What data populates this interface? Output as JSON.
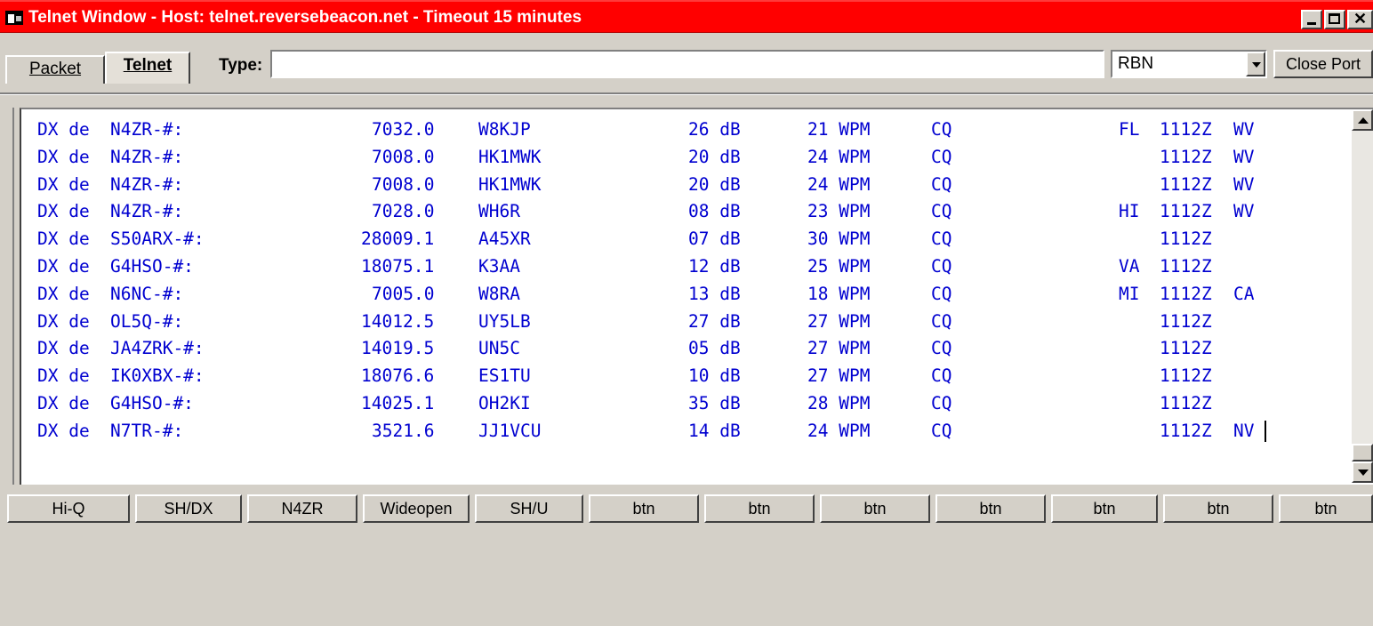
{
  "window": {
    "title": "Telnet Window - Host: telnet.reversebeacon.net - Timeout 15 minutes"
  },
  "tabs": [
    {
      "label": "Packet",
      "active": false
    },
    {
      "label": "Telnet",
      "active": true
    }
  ],
  "type_field": {
    "label": "Type:",
    "value": ""
  },
  "host_select": {
    "value": "RBN"
  },
  "close_port_label": "Close Port",
  "spots": [
    {
      "prefix": "DX de",
      "spotter": "N4ZR-#:",
      "freq": "7032.0",
      "call": "W8KJP",
      "snr": "26 dB",
      "speed": "21 WPM",
      "type": "CQ",
      "state": "FL",
      "time": "1112Z",
      "loc": "WV"
    },
    {
      "prefix": "DX de",
      "spotter": "N4ZR-#:",
      "freq": "7008.0",
      "call": "HK1MWK",
      "snr": "20 dB",
      "speed": "24 WPM",
      "type": "CQ",
      "state": "",
      "time": "1112Z",
      "loc": "WV"
    },
    {
      "prefix": "DX de",
      "spotter": "N4ZR-#:",
      "freq": "7008.0",
      "call": "HK1MWK",
      "snr": "20 dB",
      "speed": "24 WPM",
      "type": "CQ",
      "state": "",
      "time": "1112Z",
      "loc": "WV"
    },
    {
      "prefix": "DX de",
      "spotter": "N4ZR-#:",
      "freq": "7028.0",
      "call": "WH6R",
      "snr": "08 dB",
      "speed": "23 WPM",
      "type": "CQ",
      "state": "HI",
      "time": "1112Z",
      "loc": "WV"
    },
    {
      "prefix": "DX de",
      "spotter": "S50ARX-#:",
      "freq": "28009.1",
      "call": "A45XR",
      "snr": "07 dB",
      "speed": "30 WPM",
      "type": "CQ",
      "state": "",
      "time": "1112Z",
      "loc": ""
    },
    {
      "prefix": "DX de",
      "spotter": "G4HSO-#:",
      "freq": "18075.1",
      "call": "K3AA",
      "snr": "12 dB",
      "speed": "25 WPM",
      "type": "CQ",
      "state": "VA",
      "time": "1112Z",
      "loc": ""
    },
    {
      "prefix": "DX de",
      "spotter": "N6NC-#:",
      "freq": "7005.0",
      "call": "W8RA",
      "snr": "13 dB",
      "speed": "18 WPM",
      "type": "CQ",
      "state": "MI",
      "time": "1112Z",
      "loc": "CA"
    },
    {
      "prefix": "DX de",
      "spotter": "OL5Q-#:",
      "freq": "14012.5",
      "call": "UY5LB",
      "snr": "27 dB",
      "speed": "27 WPM",
      "type": "CQ",
      "state": "",
      "time": "1112Z",
      "loc": ""
    },
    {
      "prefix": "DX de",
      "spotter": "JA4ZRK-#:",
      "freq": "14019.5",
      "call": "UN5C",
      "snr": "05 dB",
      "speed": "27 WPM",
      "type": "CQ",
      "state": "",
      "time": "1112Z",
      "loc": ""
    },
    {
      "prefix": "DX de",
      "spotter": "IK0XBX-#:",
      "freq": "18076.6",
      "call": "ES1TU",
      "snr": "10 dB",
      "speed": "27 WPM",
      "type": "CQ",
      "state": "",
      "time": "1112Z",
      "loc": ""
    },
    {
      "prefix": "DX de",
      "spotter": "G4HSO-#:",
      "freq": "14025.1",
      "call": "OH2KI",
      "snr": "35 dB",
      "speed": "28 WPM",
      "type": "CQ",
      "state": "",
      "time": "1112Z",
      "loc": ""
    },
    {
      "prefix": "DX de",
      "spotter": "N7TR-#:",
      "freq": "3521.6",
      "call": "JJ1VCU",
      "snr": "14 dB",
      "speed": "24 WPM",
      "type": "CQ",
      "state": "",
      "time": "1112Z",
      "loc": "NV"
    }
  ],
  "macro_buttons": [
    "Hi-Q",
    "SH/DX",
    "N4ZR",
    "Wideopen",
    "SH/U",
    "btn",
    "btn",
    "btn",
    "btn",
    "btn",
    "btn",
    "btn"
  ],
  "colors": {
    "titlebar": "#ff0000",
    "spot_text": "#0000d0",
    "chrome": "#d4d0c8"
  }
}
